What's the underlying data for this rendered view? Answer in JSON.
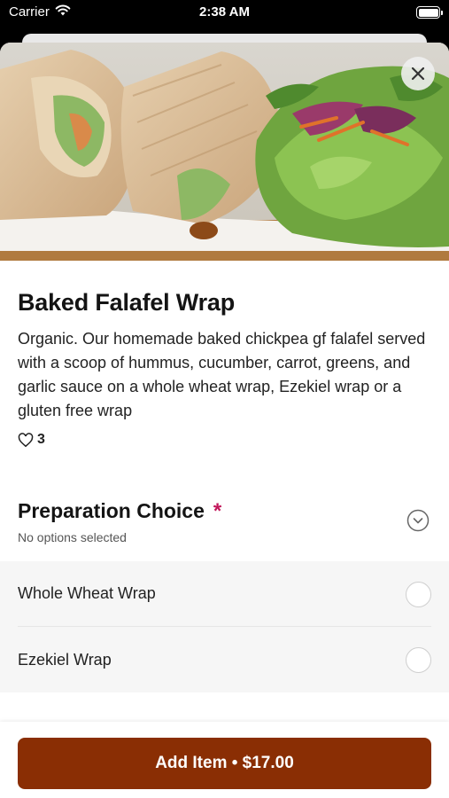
{
  "status_bar": {
    "carrier": "Carrier",
    "time": "2:38 AM",
    "icons": [
      "wifi-icon",
      "battery-icon"
    ]
  },
  "item": {
    "title": "Baked Falafel Wrap",
    "description": "Organic. Our homemade baked chickpea gf falafel served with a scoop of hummus, cucumber, carrot, greens, and garlic sauce on a whole wheat wrap, Ezekiel wrap or a gluten free wrap",
    "likes": "3"
  },
  "preparation": {
    "title": "Preparation Choice",
    "required_mark": "*",
    "subtitle": "No options selected",
    "options": [
      {
        "label": "Whole Wheat Wrap",
        "selected": false
      },
      {
        "label": "Ezekiel Wrap",
        "selected": false
      }
    ]
  },
  "footer": {
    "add_button_label": "Add Item • $17.00"
  },
  "colors": {
    "accent": "#8a2e04",
    "required": "#c2185b"
  }
}
